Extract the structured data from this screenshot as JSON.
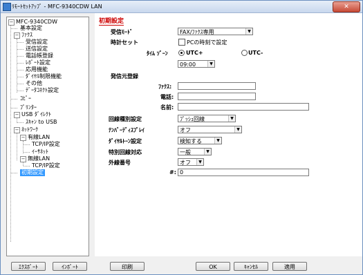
{
  "window": {
    "title": "ﾘﾓｰﾄｾｯﾄｱｯﾌﾟ - MFC-9340CDW LAN",
    "close_label": "✕"
  },
  "tree": {
    "root": "MFC-9340CDW",
    "basic": "基本設定",
    "fax": "ﾌｧｸｽ",
    "fax_items": [
      "受信設定",
      "送信設定",
      "電話帳登録",
      "ﾚﾎﾟｰﾄ設定",
      "応用機能",
      "ﾀﾞｲﾔﾙ制限機能",
      "その他",
      "ﾃﾞｰﾀｺﾈｸﾄ設定"
    ],
    "copy": "ｺﾋﾟｰ",
    "printer": "ﾌﾟﾘﾝﾀｰ",
    "usb": "USB ﾀﾞｲﾚｸﾄ",
    "usb_scan": "ｽｷｬﾝ to USB",
    "network": "ﾈｯﾄﾜｰｸ",
    "wired": "有線LAN",
    "wired_tcp": "TCP/IP設定",
    "ethernet": "ｲｰｻﾈｯﾄ",
    "wireless": "無線LAN",
    "wireless_tcp": "TCP/IP設定",
    "initial": "初期設定"
  },
  "main": {
    "section_title": "初期設定",
    "receive_mode_label": "受信ﾓｰﾄﾞ",
    "receive_mode_value": "FAX/ﾌｧｸｽ専用",
    "clock_label": "時計セット",
    "pc_time_label": "PCの時刻で設定",
    "timezone_label": "ﾀｲﾑ ｿﾞｰﾝ",
    "utc_plus": "UTC+",
    "utc_minus": "UTC-",
    "timezone_value": "09:00",
    "sender_label": "発信元登録",
    "fax_field_label": "ﾌｧｸｽ:",
    "phone_field_label": "電話:",
    "name_field_label": "名前:",
    "line_type_label": "回線種別設定",
    "line_type_value": "ﾌﾟｯｼｭ回線",
    "number_display_label": "ﾅﾝﾊﾞｰﾃﾞｨｽﾌﾟﾚｲ",
    "number_display_value": "オフ",
    "dial_tone_label": "ﾀﾞｲﾔﾙﾄｰﾝ設定",
    "dial_tone_value": "検知する",
    "special_line_label": "特別回線対応",
    "special_line_value": "一般",
    "outside_line_label": "外線番号",
    "outside_line_value": "オフ",
    "hash_label": "#:",
    "hash_value": "0"
  },
  "footer": {
    "export": "ｴｸｽﾎﾟｰﾄ",
    "import": "ｲﾝﾎﾟｰﾄ",
    "print": "印刷",
    "ok": "OK",
    "cancel": "ｷｬﾝｾﾙ",
    "apply": "適用"
  }
}
